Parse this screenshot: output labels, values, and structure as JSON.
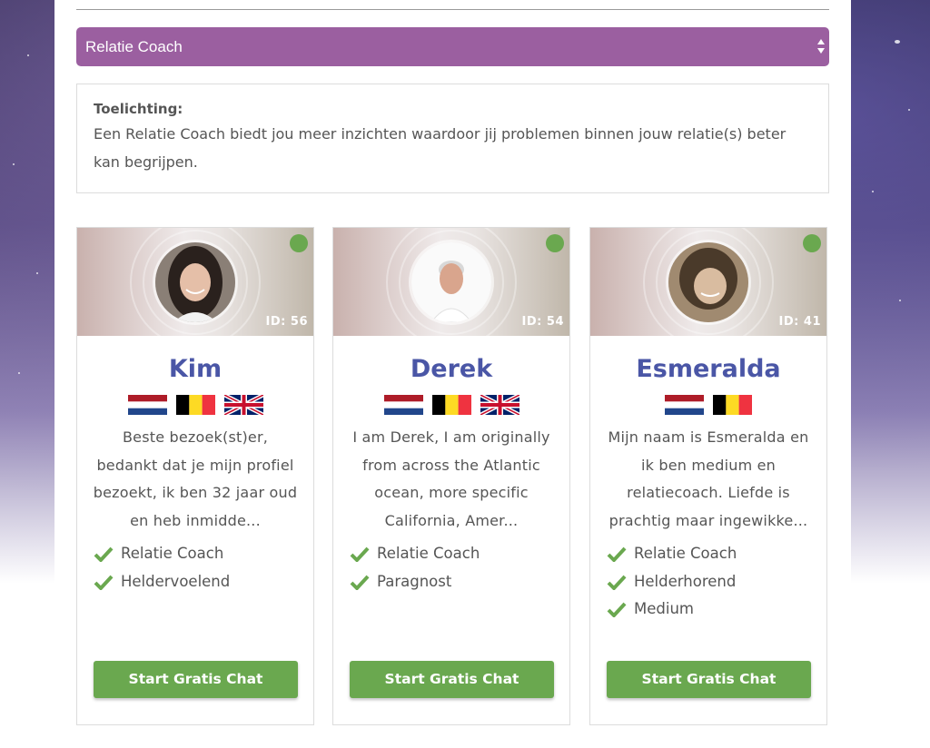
{
  "category_select": {
    "value": "Relatie Coach"
  },
  "explanation": {
    "label": "Toelichting:",
    "text": "Een Relatie Coach biedt jou meer inzichten waardoor jij problemen binnen jouw relatie(s) beter kan begrijpen."
  },
  "colors": {
    "accent_purple": "#9b5fa0",
    "name_blue": "#4a56a6",
    "online_green": "#6aa84f",
    "button_green": "#6aa84f"
  },
  "advisors": [
    {
      "name": "Kim",
      "id_label": "ID: 56",
      "status": "online",
      "flags": [
        "netherlands-flag",
        "belgium-flag",
        "uk-flag"
      ],
      "description": "Beste bezoek(st)er, bedankt dat je mijn profiel bezoekt, ik ben 32 jaar oud en heb inmidde...",
      "skills": [
        "Relatie Coach",
        "Heldervoelend"
      ],
      "button": "Start Gratis Chat"
    },
    {
      "name": "Derek",
      "id_label": "ID: 54",
      "status": "online",
      "flags": [
        "netherlands-flag",
        "belgium-flag",
        "uk-flag"
      ],
      "description": "I am Derek, I am originally from across the Atlantic ocean, more specific California, Amer...",
      "skills": [
        "Relatie Coach",
        "Paragnost"
      ],
      "button": "Start Gratis Chat"
    },
    {
      "name": "Esmeralda",
      "id_label": "ID: 41",
      "status": "online",
      "flags": [
        "netherlands-flag",
        "belgium-flag"
      ],
      "description": "Mijn naam is Esmeralda en ik ben medium en relatiecoach. Liefde is prachtig maar ingewikke...",
      "skills": [
        "Relatie Coach",
        "Helderhorend",
        "Medium"
      ],
      "button": "Start Gratis Chat"
    }
  ]
}
